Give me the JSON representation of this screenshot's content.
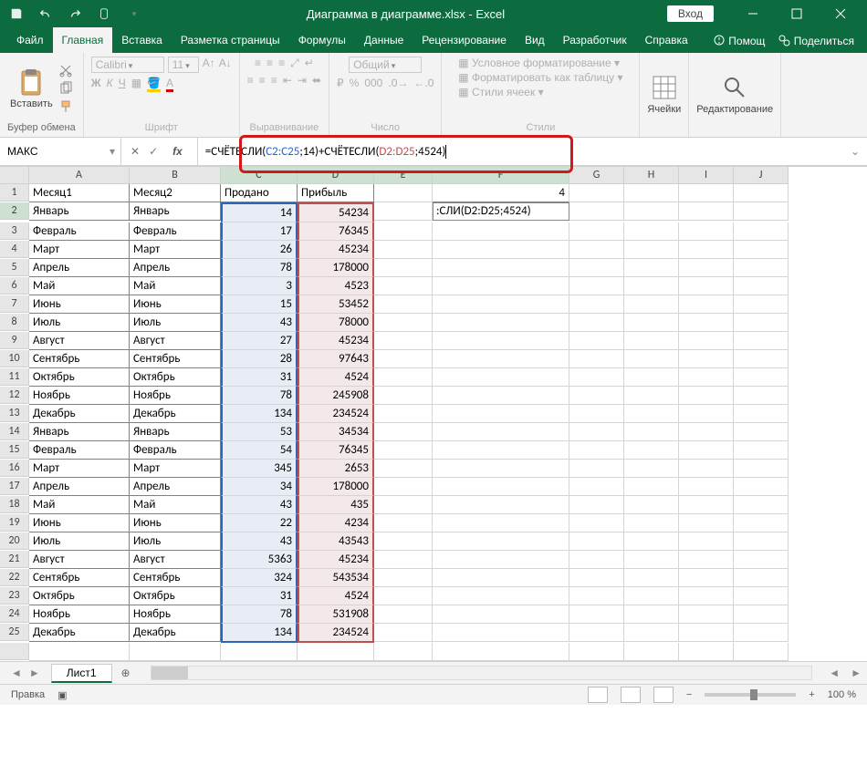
{
  "title": "Диаграмма в диаграмме.xlsx - Excel",
  "login": "Вход",
  "tabs": {
    "file": "Файл",
    "home": "Главная",
    "insert": "Вставка",
    "layout": "Разметка страницы",
    "formulas": "Формулы",
    "data": "Данные",
    "review": "Рецензирование",
    "view": "Вид",
    "developer": "Разработчик",
    "help": "Справка",
    "tellme": "Помощ",
    "share": "Поделиться"
  },
  "ribbon": {
    "paste": "Вставить",
    "clipboard": "Буфер обмена",
    "font_name": "Calibri",
    "font_size": "11",
    "font": "Шрифт",
    "align": "Выравнивание",
    "number_format": "Общий",
    "number": "Число",
    "cond_fmt": "Условное форматирование",
    "format_table": "Форматировать как таблицу",
    "cell_styles": "Стили ячеек",
    "styles": "Стили",
    "cells": "Ячейки",
    "editing": "Редактирование"
  },
  "namebox": "МАКС",
  "formula": {
    "p1": "=СЧЁТЕСЛИ(",
    "p2": "C2:C25",
    "p3": ";14)+СЧЁТЕСЛИ(",
    "p4": "D2:D25",
    "p5": ";4524)"
  },
  "columns": [
    "A",
    "B",
    "C",
    "D",
    "E",
    "F",
    "G",
    "H",
    "I",
    "J"
  ],
  "headers": {
    "a": "Месяц1",
    "b": "Месяц2",
    "c": "Продано",
    "d": "Прибыль"
  },
  "f1": "4",
  "f2": ":СЛИ(D2:D25;4524)",
  "rows": [
    {
      "n": 2,
      "a": "Январь",
      "b": "Январь",
      "c": 14,
      "d": 54234
    },
    {
      "n": 3,
      "a": "Февраль",
      "b": "Февраль",
      "c": 17,
      "d": 76345
    },
    {
      "n": 4,
      "a": "Март",
      "b": "Март",
      "c": 26,
      "d": 45234
    },
    {
      "n": 5,
      "a": "Апрель",
      "b": "Апрель",
      "c": 78,
      "d": 178000
    },
    {
      "n": 6,
      "a": "Май",
      "b": "Май",
      "c": 3,
      "d": 4523
    },
    {
      "n": 7,
      "a": "Июнь",
      "b": "Июнь",
      "c": 15,
      "d": 53452
    },
    {
      "n": 8,
      "a": "Июль",
      "b": "Июль",
      "c": 43,
      "d": 78000
    },
    {
      "n": 9,
      "a": "Август",
      "b": "Август",
      "c": 27,
      "d": 45234
    },
    {
      "n": 10,
      "a": "Сентябрь",
      "b": "Сентябрь",
      "c": 28,
      "d": 97643
    },
    {
      "n": 11,
      "a": "Октябрь",
      "b": "Октябрь",
      "c": 31,
      "d": 4524
    },
    {
      "n": 12,
      "a": "Ноябрь",
      "b": "Ноябрь",
      "c": 78,
      "d": 245908
    },
    {
      "n": 13,
      "a": "Декабрь",
      "b": "Декабрь",
      "c": 134,
      "d": 234524
    },
    {
      "n": 14,
      "a": "Январь",
      "b": "Январь",
      "c": 53,
      "d": 34534
    },
    {
      "n": 15,
      "a": "Февраль",
      "b": "Февраль",
      "c": 54,
      "d": 76345
    },
    {
      "n": 16,
      "a": "Март",
      "b": "Март",
      "c": 345,
      "d": 2653
    },
    {
      "n": 17,
      "a": "Апрель",
      "b": "Апрель",
      "c": 34,
      "d": 178000
    },
    {
      "n": 18,
      "a": "Май",
      "b": "Май",
      "c": 43,
      "d": 435
    },
    {
      "n": 19,
      "a": "Июнь",
      "b": "Июнь",
      "c": 22,
      "d": 4234
    },
    {
      "n": 20,
      "a": "Июль",
      "b": "Июль",
      "c": 43,
      "d": 43543
    },
    {
      "n": 21,
      "a": "Август",
      "b": "Август",
      "c": 5363,
      "d": 45234
    },
    {
      "n": 22,
      "a": "Сентябрь",
      "b": "Сентябрь",
      "c": 324,
      "d": 543534
    },
    {
      "n": 23,
      "a": "Октябрь",
      "b": "Октябрь",
      "c": 31,
      "d": 4524
    },
    {
      "n": 24,
      "a": "Ноябрь",
      "b": "Ноябрь",
      "c": 78,
      "d": 531908
    },
    {
      "n": 25,
      "a": "Декабрь",
      "b": "Декабрь",
      "c": 134,
      "d": 234524
    }
  ],
  "sheet_tab": "Лист1",
  "status": "Правка",
  "zoom": "100 %"
}
